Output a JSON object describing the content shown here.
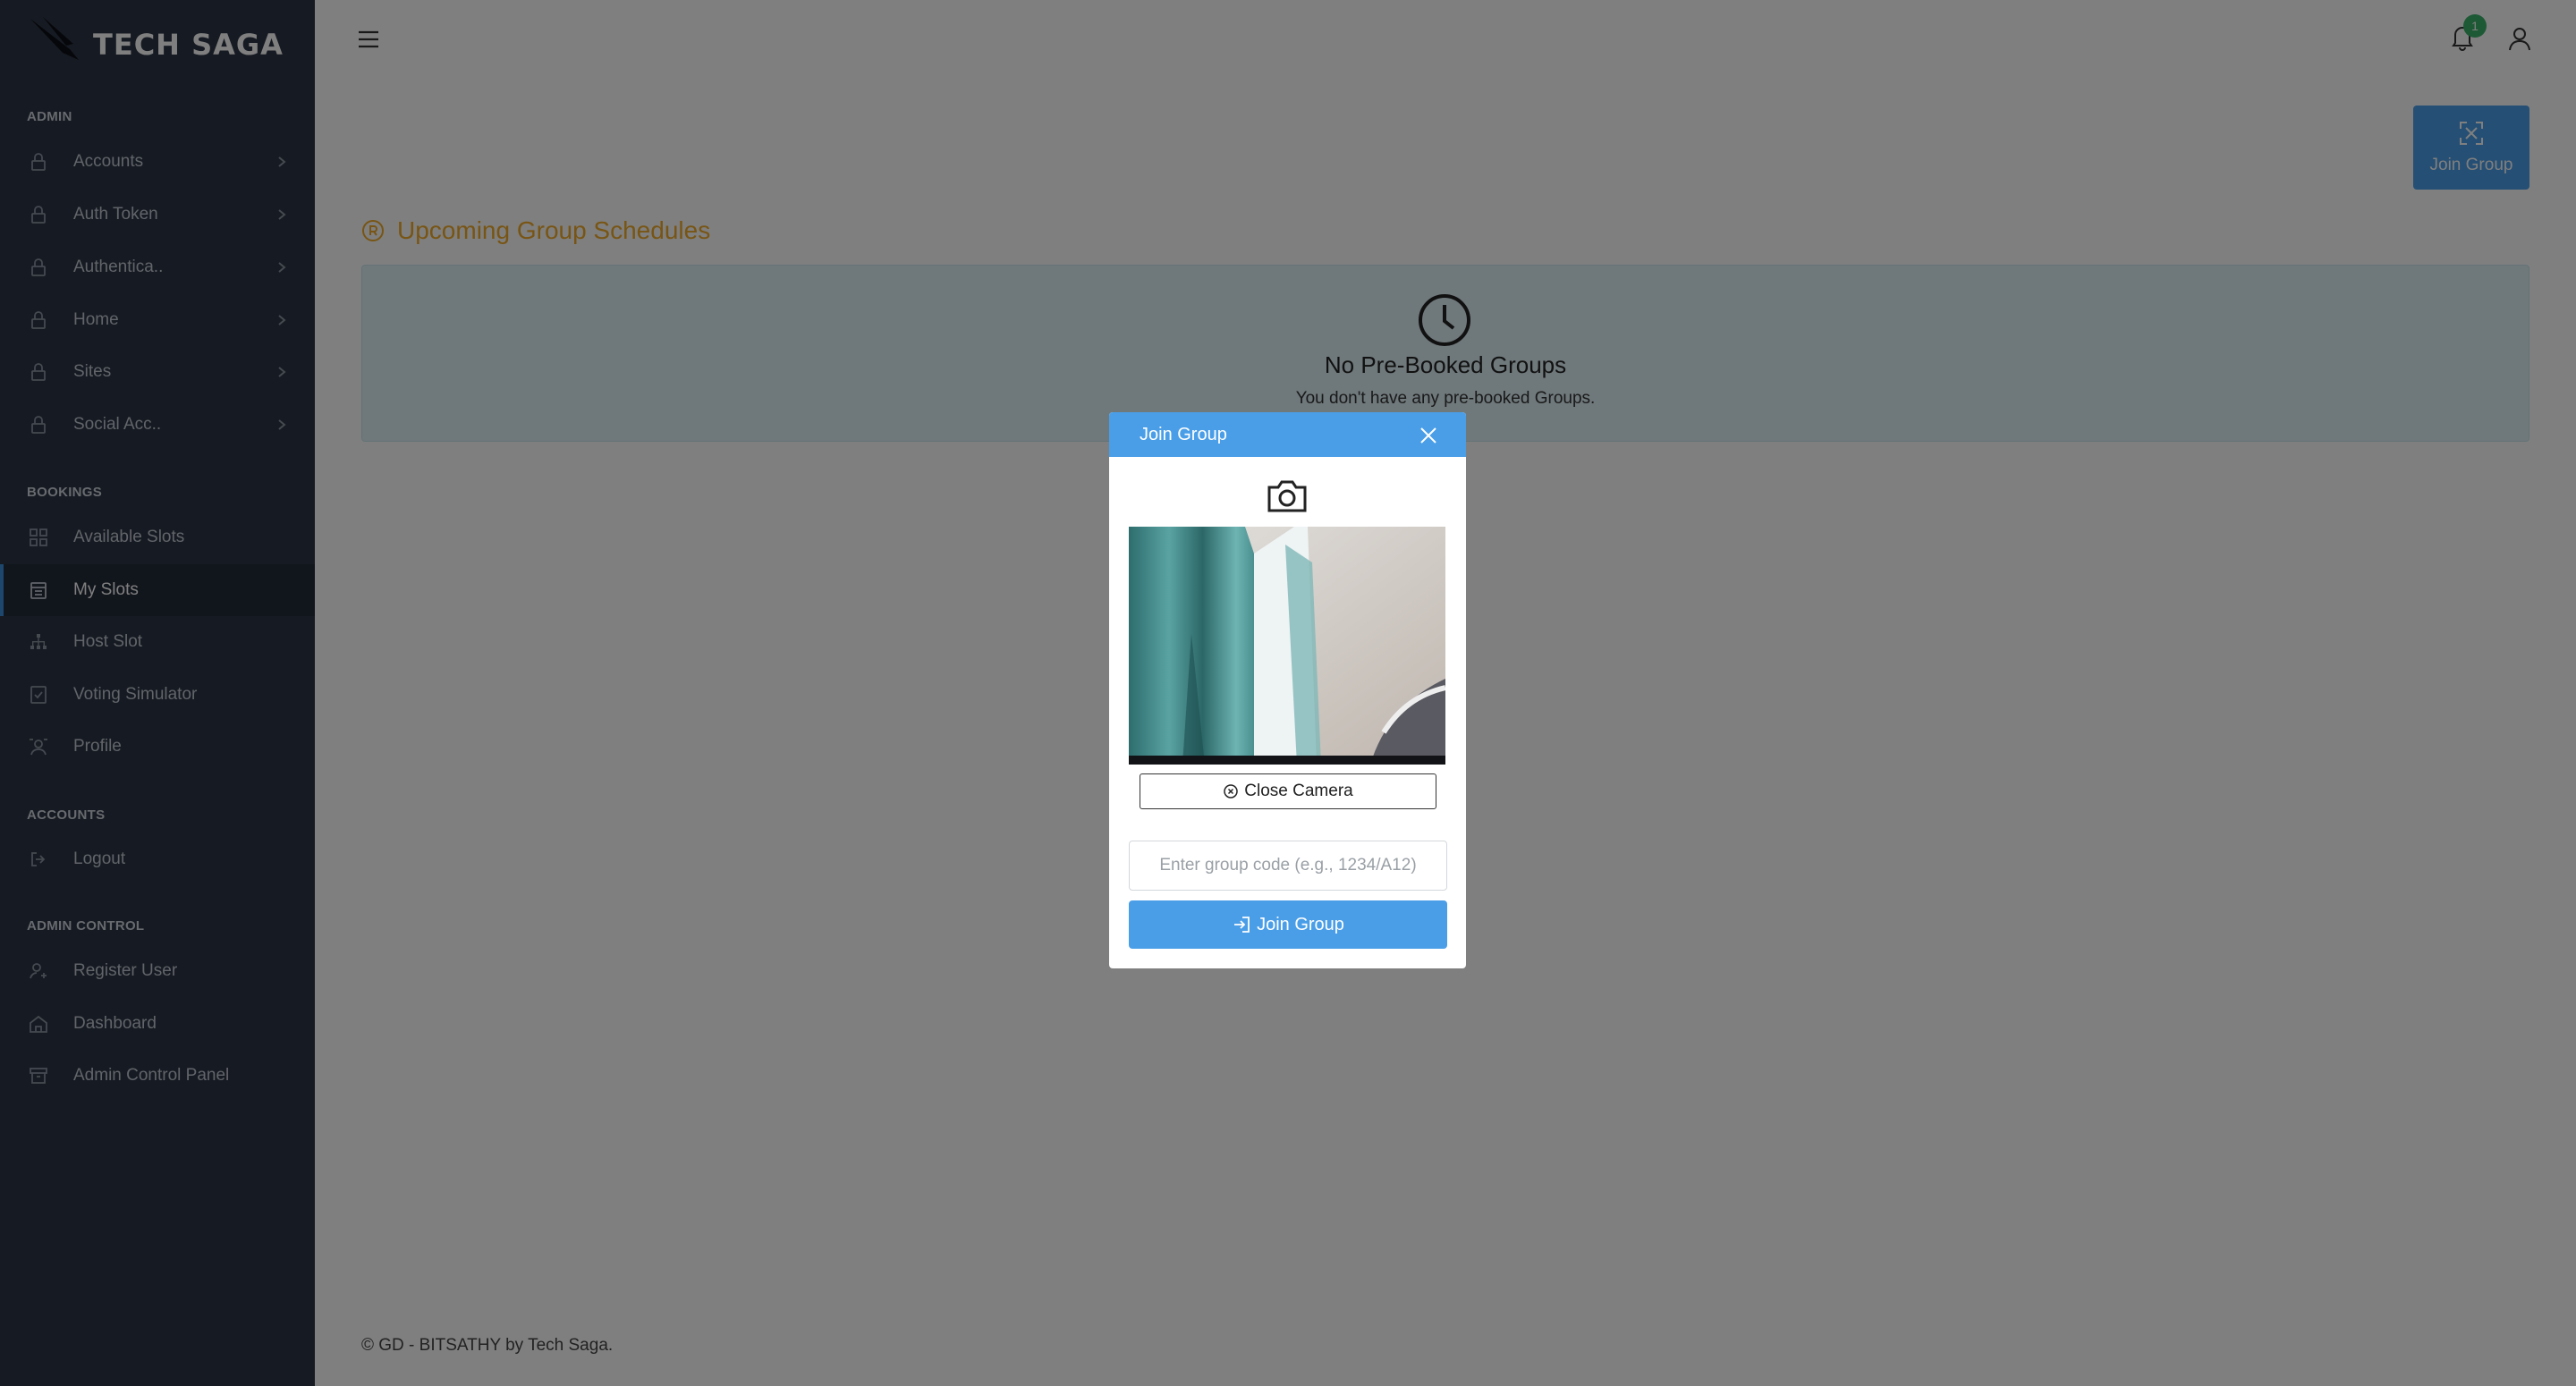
{
  "brand": {
    "name": "TECH SAGA"
  },
  "sidebar": {
    "sections": [
      {
        "label": "ADMIN"
      },
      {
        "label": "BOOKINGS"
      },
      {
        "label": "ACCOUNTS"
      },
      {
        "label": "ADMIN CONTROL"
      }
    ],
    "admin_items": [
      {
        "label": "Accounts",
        "icon": "lock-icon"
      },
      {
        "label": "Auth Token",
        "icon": "lock-icon"
      },
      {
        "label": "Authentica..",
        "icon": "lock-icon"
      },
      {
        "label": "Home",
        "icon": "lock-icon"
      },
      {
        "label": "Sites",
        "icon": "lock-icon"
      },
      {
        "label": "Social Acc..",
        "icon": "lock-icon"
      }
    ],
    "booking_items": [
      {
        "label": "Available Slots",
        "icon": "grid-icon"
      },
      {
        "label": "My Slots",
        "icon": "calendar-icon",
        "active": true
      },
      {
        "label": "Host Slot",
        "icon": "sitemap-icon"
      },
      {
        "label": "Voting Simulator",
        "icon": "vote-icon"
      },
      {
        "label": "Profile",
        "icon": "profile-icon"
      }
    ],
    "account_items": [
      {
        "label": "Logout",
        "icon": "logout-icon"
      }
    ],
    "admin_control_items": [
      {
        "label": "Register User",
        "icon": "user-add-icon"
      },
      {
        "label": "Dashboard",
        "icon": "home-icon"
      },
      {
        "label": "Admin Control Panel",
        "icon": "archive-icon"
      }
    ]
  },
  "topbar": {
    "notification_count": "1"
  },
  "main": {
    "join_button_label": "Join Group",
    "section_title": "Upcoming Group Schedules",
    "empty_title": "No Pre-Booked Groups",
    "empty_subtitle": "You don't have any pre-booked Groups."
  },
  "footer": {
    "text": "© GD - BITSATHY by Tech Saga."
  },
  "modal": {
    "title": "Join Group",
    "close_camera_label": "Close Camera",
    "code_placeholder": "Enter group code (e.g., 1234/A12)",
    "code_value": "",
    "join_label": "Join Group"
  },
  "colors": {
    "sidebar_bg": "#2c3445",
    "primary": "#4a9ee8",
    "accent_title": "#f0ab28",
    "empty_card_bg": "#dff1f6",
    "badge": "#3bb26a"
  }
}
